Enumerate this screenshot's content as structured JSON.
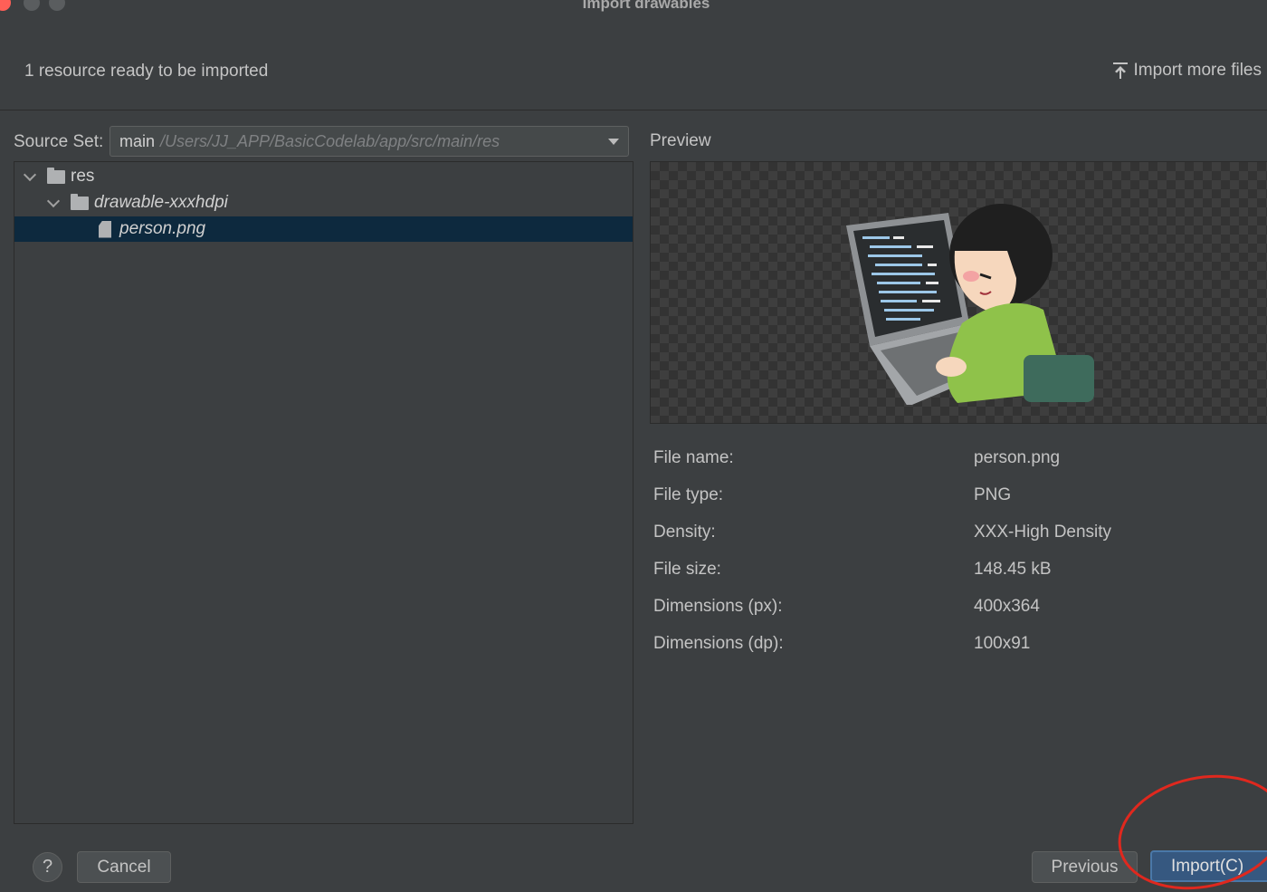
{
  "window": {
    "title": "Import drawables"
  },
  "header": {
    "status_text": "1 resource ready to be imported",
    "import_more_label": "Import more files",
    "import_more_icon": "upload-icon"
  },
  "source_set": {
    "label": "Source Set:",
    "selected_name": "main",
    "selected_path": "/Users/JJ_APP/BasicCodelab/app/src/main/res"
  },
  "tree": {
    "items": [
      {
        "label": "res",
        "icon": "folder-icon",
        "expanded": true
      },
      {
        "label": "drawable-xxxhdpi",
        "icon": "folder-icon",
        "expanded": true
      },
      {
        "label": "person.png",
        "icon": "file-icon",
        "selected": true
      }
    ]
  },
  "preview": {
    "label": "Preview"
  },
  "file_info": [
    {
      "key": "File name:",
      "value": "person.png"
    },
    {
      "key": "File type:",
      "value": "PNG"
    },
    {
      "key": "Density:",
      "value": "XXX-High Density"
    },
    {
      "key": "File size:",
      "value": "148.45 kB"
    },
    {
      "key": "Dimensions (px):",
      "value": "400x364"
    },
    {
      "key": "Dimensions (dp):",
      "value": "100x91"
    }
  ],
  "footer": {
    "help_label": "?",
    "cancel_label": "Cancel",
    "previous_label": "Previous",
    "import_label": "Import(C)"
  },
  "colors": {
    "background": "#3c3f41",
    "selection": "#0d293e",
    "primary_button": "#365880",
    "annotation": "#e0281e"
  }
}
